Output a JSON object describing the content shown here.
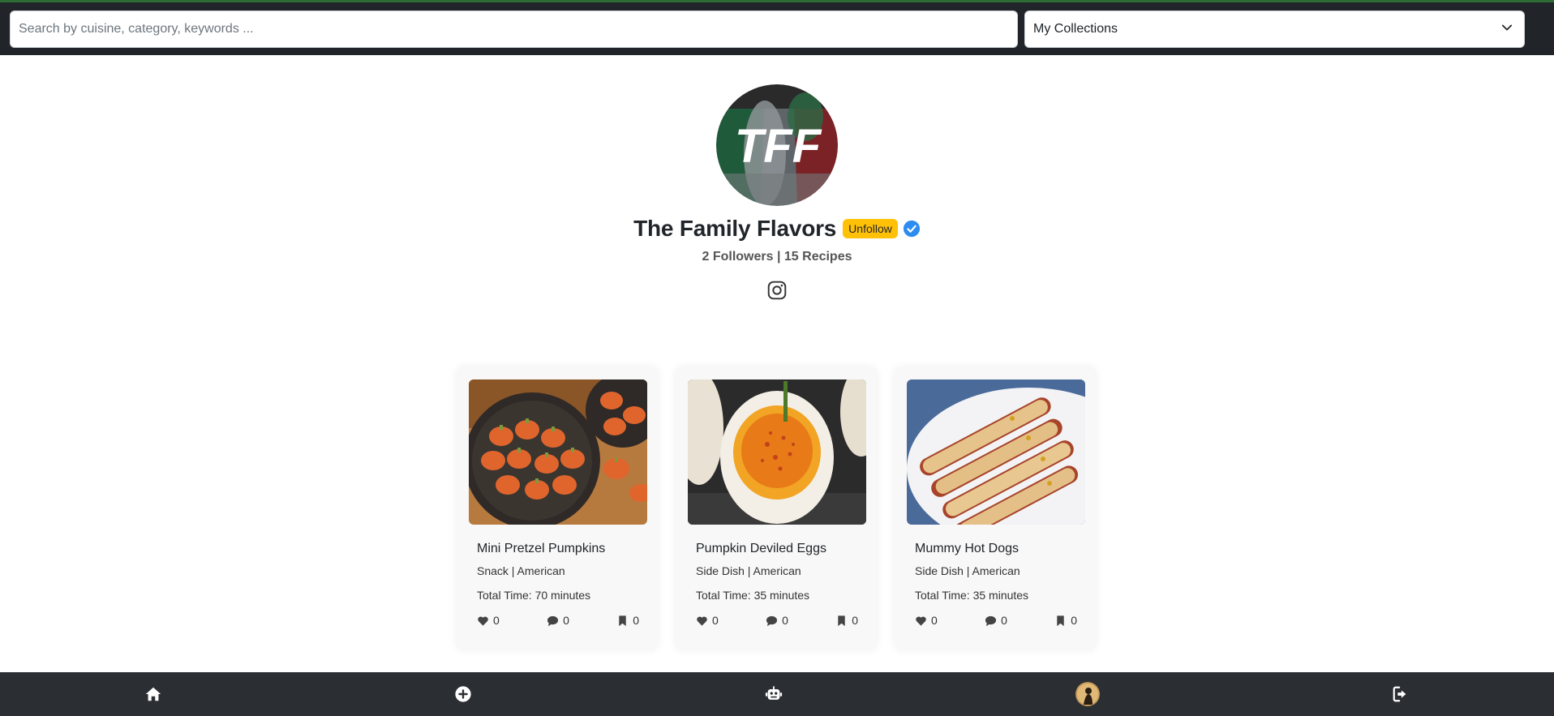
{
  "search": {
    "placeholder": "Search by cuisine, category, keywords ..."
  },
  "collections": {
    "selected": "My Collections"
  },
  "profile": {
    "avatar_text": "TFF",
    "name": "The Family Flavors",
    "follow_button": "Unfollow",
    "verified_icon": "verified-check-icon",
    "stats": "2 Followers | 15 Recipes",
    "social_icon": "instagram-icon"
  },
  "recipes": [
    {
      "title": "Mini Pretzel Pumpkins",
      "meta": "Snack | American",
      "time": "Total Time: 70 minutes",
      "likes": "0",
      "comments": "0",
      "saves": "0"
    },
    {
      "title": "Pumpkin Deviled Eggs",
      "meta": "Side Dish | American",
      "time": "Total Time: 35 minutes",
      "likes": "0",
      "comments": "0",
      "saves": "0"
    },
    {
      "title": "Mummy Hot Dogs",
      "meta": "Side Dish | American",
      "time": "Total Time: 35 minutes",
      "likes": "0",
      "comments": "0",
      "saves": "0"
    }
  ],
  "bottom_nav": {
    "items": [
      "home-icon",
      "add-circle-icon",
      "robot-icon",
      "profile-avatar",
      "logout-icon"
    ]
  },
  "colors": {
    "topbar": "#212529",
    "bottom_nav": "#2b2f33",
    "follow_button": "#ffc107",
    "verified": "#2d8cf0",
    "card_bg": "#f8f8f8"
  }
}
